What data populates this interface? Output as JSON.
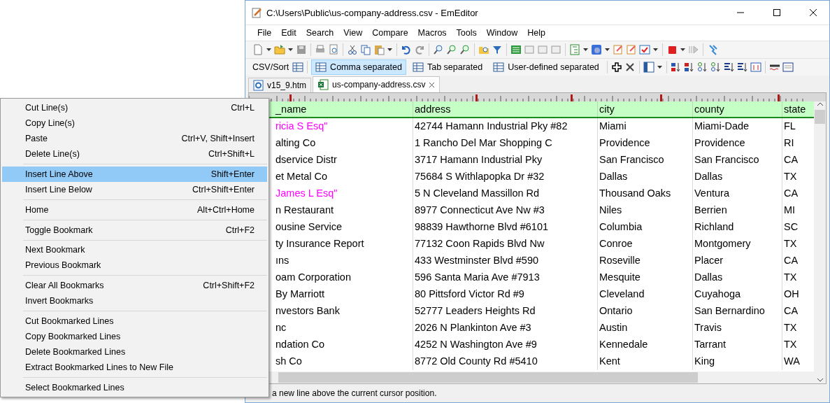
{
  "window": {
    "title": "C:\\Users\\Public\\us-company-address.csv - EmEditor"
  },
  "menu_bar": [
    "File",
    "Edit",
    "Search",
    "View",
    "Compare",
    "Macros",
    "Tools",
    "Window",
    "Help"
  ],
  "csv_toolbar": {
    "label": "CSV/Sort",
    "modes": [
      {
        "label": "Comma separated",
        "selected": true
      },
      {
        "label": "Tab separated",
        "selected": false
      },
      {
        "label": "User-defined separated",
        "selected": false
      }
    ]
  },
  "tabs": [
    {
      "label": "v15_9.htm",
      "kind": "web",
      "selected": false,
      "closable": false
    },
    {
      "label": "us-company-address.csv",
      "kind": "sheet",
      "selected": true,
      "closable": true
    }
  ],
  "table": {
    "columns": [
      "_name",
      "address",
      "city",
      "county",
      "state"
    ],
    "rows": [
      {
        "color": "#ff00ff",
        "cells": [
          "ricia S Esq\"",
          "42744 Hamann Industrial Pky #82",
          "Miami",
          "Miami-Dade",
          "FL"
        ]
      },
      {
        "color": "#000000",
        "cells": [
          "alting Co",
          "1 Rancho Del Mar Shopping C",
          "Providence",
          "Providence",
          "RI"
        ]
      },
      {
        "color": "#000000",
        "cells": [
          "dservice Distr",
          "3717 Hamann Industrial Pky",
          "San Francisco",
          "San Francisco",
          "CA"
        ]
      },
      {
        "color": "#000000",
        "cells": [
          "et Metal Co",
          "75684 S Withlapopka Dr #32",
          "Dallas",
          "Dallas",
          "TX"
        ]
      },
      {
        "color": "#ff00ff",
        "cells": [
          "James L Esq\"",
          "5 N Cleveland Massillon Rd",
          "Thousand Oaks",
          "Ventura",
          "CA"
        ]
      },
      {
        "color": "#000000",
        "cells": [
          "n Restaurant",
          "8977 Connecticut Ave Nw #3",
          "Niles",
          "Berrien",
          "MI"
        ]
      },
      {
        "color": "#000000",
        "cells": [
          "ousine Service",
          "98839 Hawthorne Blvd #6101",
          "Columbia",
          "Richland",
          "SC"
        ]
      },
      {
        "color": "#000000",
        "cells": [
          "ty Insurance Report",
          "77132 Coon Rapids Blvd Nw",
          "Conroe",
          "Montgomery",
          "TX"
        ]
      },
      {
        "color": "#000000",
        "cells": [
          "ıns",
          "433 Westminster Blvd #590",
          "Roseville",
          "Placer",
          "CA"
        ]
      },
      {
        "color": "#000000",
        "cells": [
          "oam Corporation",
          "596 Santa Maria Ave #7913",
          "Mesquite",
          "Dallas",
          "TX"
        ]
      },
      {
        "color": "#000000",
        "cells": [
          "By Marriott",
          "80 Pittsford Victor Rd #9",
          "Cleveland",
          "Cuyahoga",
          "OH"
        ]
      },
      {
        "color": "#000000",
        "cells": [
          "nvestors Bank",
          "52777 Leaders Heights Rd",
          "Ontario",
          "San Bernardino",
          "CA"
        ]
      },
      {
        "color": "#000000",
        "cells": [
          "nc",
          "2026 N Plankinton Ave #3",
          "Austin",
          "Travis",
          "TX"
        ]
      },
      {
        "color": "#000000",
        "cells": [
          "ndation Co",
          "4252 N Washington Ave #9",
          "Kennedale",
          "Tarrant",
          "TX"
        ]
      },
      {
        "color": "#000000",
        "cells": [
          "sh Co",
          "8772 Old County Rd #5410",
          "Kent",
          "King",
          "WA"
        ]
      }
    ]
  },
  "status_bar": "a new line above the current cursor position.",
  "context_menu": {
    "groups": [
      [
        {
          "label": "Cut Line(s)",
          "shortcut": "Ctrl+L",
          "selected": false
        },
        {
          "label": "Copy Line(s)",
          "selected": false
        },
        {
          "label": "Paste",
          "shortcut": "Ctrl+V, Shift+Insert",
          "selected": false
        },
        {
          "label": "Delete Line(s)",
          "shortcut": "Ctrl+Shift+L",
          "selected": false
        }
      ],
      [
        {
          "label": "Insert Line Above",
          "shortcut": "Shift+Enter",
          "selected": true
        },
        {
          "label": "Insert Line Below",
          "shortcut": "Ctrl+Shift+Enter",
          "selected": false
        }
      ],
      [
        {
          "label": "Home",
          "shortcut": "Alt+Ctrl+Home",
          "selected": false
        }
      ],
      [
        {
          "label": "Toggle Bookmark",
          "shortcut": "Ctrl+F2",
          "selected": false
        }
      ],
      [
        {
          "label": "Next Bookmark",
          "selected": false
        },
        {
          "label": "Previous Bookmark",
          "selected": false
        }
      ],
      [
        {
          "label": "Clear All Bookmarks",
          "shortcut": "Ctrl+Shift+F2",
          "selected": false
        },
        {
          "label": "Invert Bookmarks",
          "selected": false
        }
      ],
      [
        {
          "label": "Cut Bookmarked Lines",
          "selected": false
        },
        {
          "label": "Copy Bookmarked Lines",
          "selected": false
        },
        {
          "label": "Delete Bookmarked Lines",
          "selected": false
        },
        {
          "label": "Extract Bookmarked Lines to New File",
          "selected": false
        }
      ],
      [
        {
          "label": "Select Bookmarked Lines",
          "selected": false
        }
      ]
    ]
  }
}
